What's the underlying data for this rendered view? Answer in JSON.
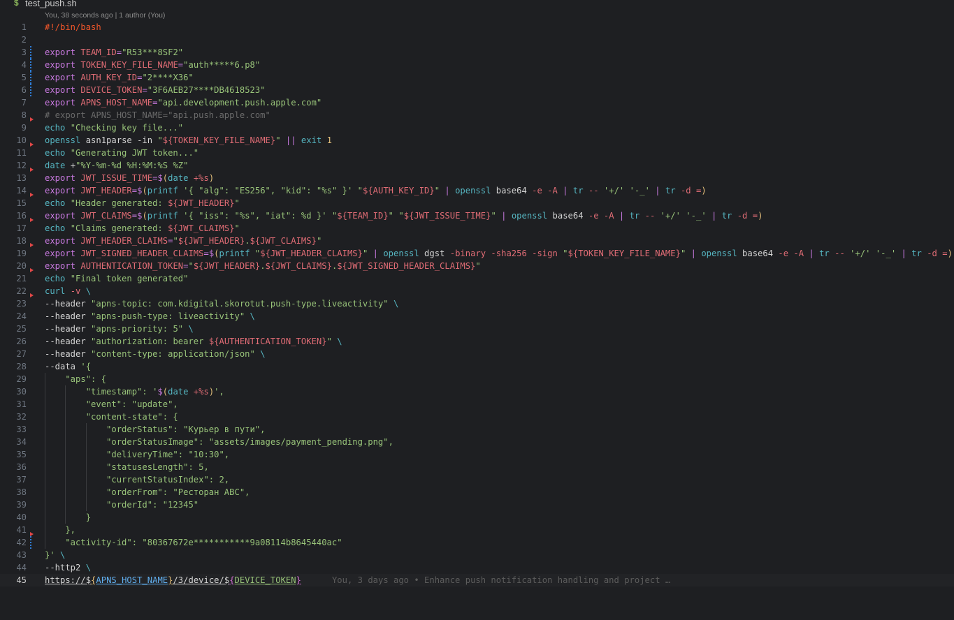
{
  "file_header": {
    "icon": "$",
    "filename": "test_push.sh"
  },
  "codelens": "You, 38 seconds ago | 1 author (You)",
  "colors": {
    "background": "#1e1f22",
    "keyword": "#c678dd",
    "command": "#56b6c2",
    "variable": "#e06c75",
    "string": "#98c379",
    "comment": "#6a6a6a",
    "shebang": "#f0562a",
    "bracket_yellow": "#e5c07b",
    "bracket_magenta": "#d16fd2",
    "bracket_blue": "#61afef",
    "plain": "#d4d4d4",
    "git_modified": "#2f7ed8",
    "git_deleted": "#e04848"
  },
  "lines": [
    {
      "n": "1",
      "tokens": [
        {
          "t": "#!/bin/bash",
          "c": "shebang"
        }
      ]
    },
    {
      "n": "2",
      "tokens": []
    },
    {
      "n": "3",
      "git": "modified",
      "tokens": [
        {
          "t": "export ",
          "c": "keyword"
        },
        {
          "t": "TEAM_ID",
          "c": "variable"
        },
        {
          "t": "=",
          "c": "keyword"
        },
        {
          "t": "\"R53***8SF2\"",
          "c": "string"
        }
      ]
    },
    {
      "n": "4",
      "git": "modified",
      "tokens": [
        {
          "t": "export ",
          "c": "keyword"
        },
        {
          "t": "TOKEN_KEY_FILE_NAME",
          "c": "variable"
        },
        {
          "t": "=",
          "c": "keyword"
        },
        {
          "t": "\"auth*****6.p8\"",
          "c": "string"
        }
      ]
    },
    {
      "n": "5",
      "git": "modified",
      "tokens": [
        {
          "t": "export ",
          "c": "keyword"
        },
        {
          "t": "AUTH_KEY_ID",
          "c": "variable"
        },
        {
          "t": "=",
          "c": "keyword"
        },
        {
          "t": "\"2****X36\"",
          "c": "string"
        }
      ]
    },
    {
      "n": "6",
      "git": "modified",
      "tokens": [
        {
          "t": "export ",
          "c": "keyword"
        },
        {
          "t": "DEVICE_TOKEN",
          "c": "variable"
        },
        {
          "t": "=",
          "c": "keyword"
        },
        {
          "t": "\"3F6AEB27****DB4618523\"",
          "c": "string"
        }
      ]
    },
    {
      "n": "7",
      "tokens": [
        {
          "t": "export ",
          "c": "keyword"
        },
        {
          "t": "APNS_HOST_NAME",
          "c": "variable"
        },
        {
          "t": "=",
          "c": "keyword"
        },
        {
          "t": "\"api.development.push.apple.com\"",
          "c": "string"
        }
      ]
    },
    {
      "n": "8",
      "git": "deleted",
      "tokens": [
        {
          "t": "# export APNS_HOST_NAME=\"api.push.apple.com\"",
          "c": "comment"
        }
      ]
    },
    {
      "n": "9",
      "tokens": [
        {
          "t": "echo ",
          "c": "command"
        },
        {
          "t": "\"Checking key file...\"",
          "c": "string"
        }
      ]
    },
    {
      "n": "10",
      "git": "deleted",
      "tokens": [
        {
          "t": "openssl ",
          "c": "command"
        },
        {
          "t": "asn1parse -in ",
          "c": "plain"
        },
        {
          "t": "\"",
          "c": "string"
        },
        {
          "t": "${TOKEN_KEY_FILE_NAME}",
          "c": "variable"
        },
        {
          "t": "\"",
          "c": "string"
        },
        {
          "t": " || ",
          "c": "keyword"
        },
        {
          "t": "exit ",
          "c": "command"
        },
        {
          "t": "1",
          "c": "bracket_yellow"
        }
      ]
    },
    {
      "n": "11",
      "tokens": [
        {
          "t": "echo ",
          "c": "command"
        },
        {
          "t": "\"Generating JWT token...\"",
          "c": "string"
        }
      ]
    },
    {
      "n": "12",
      "git": "deleted",
      "tokens": [
        {
          "t": "date ",
          "c": "command"
        },
        {
          "t": "+",
          "c": "plain"
        },
        {
          "t": "\"%Y-%m-%d %H:%M:%S %Z\"",
          "c": "string"
        }
      ]
    },
    {
      "n": "13",
      "tokens": [
        {
          "t": "export ",
          "c": "keyword"
        },
        {
          "t": "JWT_ISSUE_TIME",
          "c": "variable"
        },
        {
          "t": "=$",
          "c": "keyword"
        },
        {
          "t": "(",
          "c": "bracket_yellow"
        },
        {
          "t": "date ",
          "c": "command"
        },
        {
          "t": "+%s",
          "c": "variable"
        },
        {
          "t": ")",
          "c": "bracket_yellow"
        }
      ]
    },
    {
      "n": "14",
      "git": "deleted",
      "tokens": [
        {
          "t": "export ",
          "c": "keyword"
        },
        {
          "t": "JWT_HEADER",
          "c": "variable"
        },
        {
          "t": "=$",
          "c": "keyword"
        },
        {
          "t": "(",
          "c": "bracket_yellow"
        },
        {
          "t": "printf ",
          "c": "command"
        },
        {
          "t": "'{ \"alg\": \"ES256\", \"kid\": \"%s\" }'",
          "c": "string"
        },
        {
          "t": " ",
          "c": "plain"
        },
        {
          "t": "\"",
          "c": "string"
        },
        {
          "t": "${AUTH_KEY_ID}",
          "c": "variable"
        },
        {
          "t": "\"",
          "c": "string"
        },
        {
          "t": " | ",
          "c": "keyword"
        },
        {
          "t": "openssl ",
          "c": "command"
        },
        {
          "t": "base64 ",
          "c": "plain"
        },
        {
          "t": "-e -A",
          "c": "variable"
        },
        {
          "t": " | ",
          "c": "keyword"
        },
        {
          "t": "tr ",
          "c": "command"
        },
        {
          "t": "-- ",
          "c": "variable"
        },
        {
          "t": "'+/' '-_'",
          "c": "string"
        },
        {
          "t": " | ",
          "c": "keyword"
        },
        {
          "t": "tr ",
          "c": "command"
        },
        {
          "t": "-d =",
          "c": "variable"
        },
        {
          "t": ")",
          "c": "bracket_yellow"
        }
      ]
    },
    {
      "n": "15",
      "tokens": [
        {
          "t": "echo ",
          "c": "command"
        },
        {
          "t": "\"Header generated: ",
          "c": "string"
        },
        {
          "t": "${JWT_HEADER}",
          "c": "variable"
        },
        {
          "t": "\"",
          "c": "string"
        }
      ]
    },
    {
      "n": "16",
      "git": "deleted",
      "tokens": [
        {
          "t": "export ",
          "c": "keyword"
        },
        {
          "t": "JWT_CLAIMS",
          "c": "variable"
        },
        {
          "t": "=$",
          "c": "keyword"
        },
        {
          "t": "(",
          "c": "bracket_yellow"
        },
        {
          "t": "printf ",
          "c": "command"
        },
        {
          "t": "'{ \"iss\": \"%s\", \"iat\": %d }'",
          "c": "string"
        },
        {
          "t": " ",
          "c": "plain"
        },
        {
          "t": "\"",
          "c": "string"
        },
        {
          "t": "${TEAM_ID}",
          "c": "variable"
        },
        {
          "t": "\"",
          "c": "string"
        },
        {
          "t": " ",
          "c": "plain"
        },
        {
          "t": "\"",
          "c": "string"
        },
        {
          "t": "${JWT_ISSUE_TIME}",
          "c": "variable"
        },
        {
          "t": "\"",
          "c": "string"
        },
        {
          "t": " | ",
          "c": "keyword"
        },
        {
          "t": "openssl ",
          "c": "command"
        },
        {
          "t": "base64 ",
          "c": "plain"
        },
        {
          "t": "-e -A",
          "c": "variable"
        },
        {
          "t": " | ",
          "c": "keyword"
        },
        {
          "t": "tr ",
          "c": "command"
        },
        {
          "t": "-- ",
          "c": "variable"
        },
        {
          "t": "'+/' '-_'",
          "c": "string"
        },
        {
          "t": " | ",
          "c": "keyword"
        },
        {
          "t": "tr ",
          "c": "command"
        },
        {
          "t": "-d =",
          "c": "variable"
        },
        {
          "t": ")",
          "c": "bracket_yellow"
        }
      ]
    },
    {
      "n": "17",
      "tokens": [
        {
          "t": "echo ",
          "c": "command"
        },
        {
          "t": "\"Claims generated: ",
          "c": "string"
        },
        {
          "t": "${JWT_CLAIMS}",
          "c": "variable"
        },
        {
          "t": "\"",
          "c": "string"
        }
      ]
    },
    {
      "n": "18",
      "git": "deleted",
      "tokens": [
        {
          "t": "export ",
          "c": "keyword"
        },
        {
          "t": "JWT_HEADER_CLAIMS",
          "c": "variable"
        },
        {
          "t": "=",
          "c": "keyword"
        },
        {
          "t": "\"",
          "c": "string"
        },
        {
          "t": "${JWT_HEADER}",
          "c": "variable"
        },
        {
          "t": ".",
          "c": "string"
        },
        {
          "t": "${JWT_CLAIMS}",
          "c": "variable"
        },
        {
          "t": "\"",
          "c": "string"
        }
      ]
    },
    {
      "n": "19",
      "tokens": [
        {
          "t": "export ",
          "c": "keyword"
        },
        {
          "t": "JWT_SIGNED_HEADER_CLAIMS",
          "c": "variable"
        },
        {
          "t": "=$",
          "c": "keyword"
        },
        {
          "t": "(",
          "c": "bracket_yellow"
        },
        {
          "t": "printf ",
          "c": "command"
        },
        {
          "t": "\"",
          "c": "string"
        },
        {
          "t": "${JWT_HEADER_CLAIMS}",
          "c": "variable"
        },
        {
          "t": "\"",
          "c": "string"
        },
        {
          "t": " | ",
          "c": "keyword"
        },
        {
          "t": "openssl ",
          "c": "command"
        },
        {
          "t": "dgst ",
          "c": "plain"
        },
        {
          "t": "-binary -sha256 -sign ",
          "c": "variable"
        },
        {
          "t": "\"",
          "c": "string"
        },
        {
          "t": "${TOKEN_KEY_FILE_NAME}",
          "c": "variable"
        },
        {
          "t": "\"",
          "c": "string"
        },
        {
          "t": " | ",
          "c": "keyword"
        },
        {
          "t": "openssl ",
          "c": "command"
        },
        {
          "t": "base64 ",
          "c": "plain"
        },
        {
          "t": "-e -A",
          "c": "variable"
        },
        {
          "t": " | ",
          "c": "keyword"
        },
        {
          "t": "tr ",
          "c": "command"
        },
        {
          "t": "-- ",
          "c": "variable"
        },
        {
          "t": "'+/' '-_'",
          "c": "string"
        },
        {
          "t": " | ",
          "c": "keyword"
        },
        {
          "t": "tr ",
          "c": "command"
        },
        {
          "t": "-d =",
          "c": "variable"
        },
        {
          "t": ")",
          "c": "bracket_yellow"
        }
      ]
    },
    {
      "n": "20",
      "git": "deleted",
      "tokens": [
        {
          "t": "export ",
          "c": "keyword"
        },
        {
          "t": "AUTHENTICATION_TOKEN",
          "c": "variable"
        },
        {
          "t": "=",
          "c": "keyword"
        },
        {
          "t": "\"",
          "c": "string"
        },
        {
          "t": "${JWT_HEADER}",
          "c": "variable"
        },
        {
          "t": ".",
          "c": "string"
        },
        {
          "t": "${JWT_CLAIMS}",
          "c": "variable"
        },
        {
          "t": ".",
          "c": "string"
        },
        {
          "t": "${JWT_SIGNED_HEADER_CLAIMS}",
          "c": "variable"
        },
        {
          "t": "\"",
          "c": "string"
        }
      ]
    },
    {
      "n": "21",
      "tokens": [
        {
          "t": "echo ",
          "c": "command"
        },
        {
          "t": "\"Final token generated\"",
          "c": "string"
        }
      ]
    },
    {
      "n": "22",
      "git": "deleted",
      "tokens": [
        {
          "t": "curl ",
          "c": "command"
        },
        {
          "t": "-v ",
          "c": "variable"
        },
        {
          "t": "\\",
          "c": "command"
        }
      ]
    },
    {
      "n": "23",
      "tokens": [
        {
          "t": "--header ",
          "c": "plain"
        },
        {
          "t": "\"apns-topic: com.kdigital.skorotut.push-type.liveactivity\"",
          "c": "string"
        },
        {
          "t": " \\",
          "c": "command"
        }
      ]
    },
    {
      "n": "24",
      "tokens": [
        {
          "t": "--header ",
          "c": "plain"
        },
        {
          "t": "\"apns-push-type: liveactivity\"",
          "c": "string"
        },
        {
          "t": " \\",
          "c": "command"
        }
      ]
    },
    {
      "n": "25",
      "tokens": [
        {
          "t": "--header ",
          "c": "plain"
        },
        {
          "t": "\"apns-priority: 5\"",
          "c": "string"
        },
        {
          "t": " \\",
          "c": "command"
        }
      ]
    },
    {
      "n": "26",
      "tokens": [
        {
          "t": "--header ",
          "c": "plain"
        },
        {
          "t": "\"authorization: bearer ",
          "c": "string"
        },
        {
          "t": "${AUTHENTICATION_TOKEN}",
          "c": "variable"
        },
        {
          "t": "\"",
          "c": "string"
        },
        {
          "t": " \\",
          "c": "command"
        }
      ]
    },
    {
      "n": "27",
      "tokens": [
        {
          "t": "--header ",
          "c": "plain"
        },
        {
          "t": "\"content-type: application/json\"",
          "c": "string"
        },
        {
          "t": " \\",
          "c": "command"
        }
      ]
    },
    {
      "n": "28",
      "tokens": [
        {
          "t": "--data ",
          "c": "plain"
        },
        {
          "t": "'{",
          "c": "string"
        }
      ]
    },
    {
      "n": "29",
      "indent": 1,
      "tokens": [
        {
          "t": "    \"aps\": {",
          "c": "string"
        }
      ]
    },
    {
      "n": "30",
      "indent": 2,
      "tokens": [
        {
          "t": "        \"timestamp\": '",
          "c": "string"
        },
        {
          "t": "$",
          "c": "keyword"
        },
        {
          "t": "(",
          "c": "bracket_yellow"
        },
        {
          "t": "date ",
          "c": "command"
        },
        {
          "t": "+%s",
          "c": "variable"
        },
        {
          "t": ")",
          "c": "bracket_yellow"
        },
        {
          "t": "',",
          "c": "string"
        }
      ]
    },
    {
      "n": "31",
      "indent": 2,
      "tokens": [
        {
          "t": "        \"event\": \"update\",",
          "c": "string"
        }
      ]
    },
    {
      "n": "32",
      "indent": 2,
      "tokens": [
        {
          "t": "        \"content-state\": {",
          "c": "string"
        }
      ]
    },
    {
      "n": "33",
      "indent": 3,
      "tokens": [
        {
          "t": "            \"orderStatus\": \"Курьер в пути\",",
          "c": "string"
        }
      ]
    },
    {
      "n": "34",
      "indent": 3,
      "tokens": [
        {
          "t": "            \"orderStatusImage\": \"assets/images/payment_pending.png\",",
          "c": "string"
        }
      ]
    },
    {
      "n": "35",
      "indent": 3,
      "tokens": [
        {
          "t": "            \"deliveryTime\": \"10:30\",",
          "c": "string"
        }
      ]
    },
    {
      "n": "36",
      "indent": 3,
      "tokens": [
        {
          "t": "            \"statusesLength\": 5,",
          "c": "string"
        }
      ]
    },
    {
      "n": "37",
      "indent": 3,
      "tokens": [
        {
          "t": "            \"currentStatusIndex\": 2,",
          "c": "string"
        }
      ]
    },
    {
      "n": "38",
      "indent": 3,
      "tokens": [
        {
          "t": "            \"orderFrom\": \"Ресторан АВС\",",
          "c": "string"
        }
      ]
    },
    {
      "n": "39",
      "indent": 3,
      "tokens": [
        {
          "t": "            \"orderId\": \"12345\"",
          "c": "string"
        }
      ]
    },
    {
      "n": "40",
      "indent": 2,
      "tokens": [
        {
          "t": "        }",
          "c": "string"
        }
      ]
    },
    {
      "n": "41",
      "indent": 1,
      "git": "deleted",
      "tokens": [
        {
          "t": "    },",
          "c": "string"
        }
      ]
    },
    {
      "n": "42",
      "indent": 1,
      "git": "modified",
      "tokens": [
        {
          "t": "    \"activity-id\": \"80367672e***********9a08114b8645440ac\"",
          "c": "string"
        }
      ]
    },
    {
      "n": "43",
      "tokens": [
        {
          "t": "}'",
          "c": "string"
        },
        {
          "t": " \\",
          "c": "command"
        }
      ]
    },
    {
      "n": "44",
      "tokens": [
        {
          "t": "--http2 ",
          "c": "plain"
        },
        {
          "t": "\\",
          "c": "command"
        }
      ]
    },
    {
      "n": "45",
      "current": true,
      "tokens": [
        {
          "t": "https://$",
          "c": "plain",
          "u": true
        },
        {
          "t": "{",
          "c": "bracket_yellow",
          "u": true
        },
        {
          "t": "APNS_HOST_NAME",
          "c": "bracket_blue",
          "u": true
        },
        {
          "t": "}",
          "c": "bracket_yellow",
          "u": true
        },
        {
          "t": "/3/device/$",
          "c": "plain",
          "u": true
        },
        {
          "t": "{",
          "c": "bracket_magenta",
          "u": true
        },
        {
          "t": "DEVICE_TOKEN",
          "c": "string",
          "u": true
        },
        {
          "t": "}",
          "c": "bracket_magenta",
          "u": true
        }
      ],
      "blame": "You, 3 days ago • Enhance push notification handling and project …"
    }
  ]
}
